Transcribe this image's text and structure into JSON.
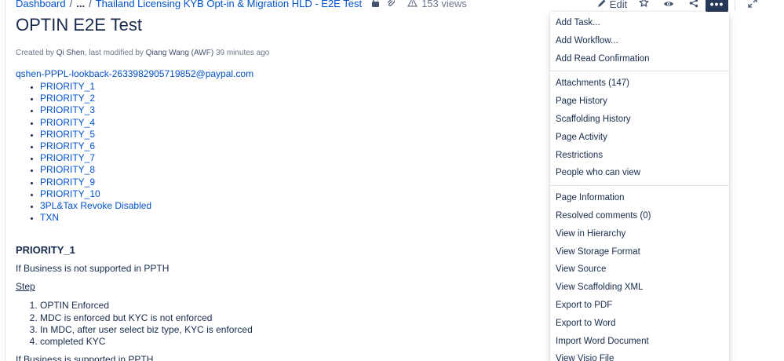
{
  "breadcrumb": {
    "root": "Dashboard",
    "sep1": "/",
    "ellipsis": "...",
    "sep2": "/",
    "parent": "Thailand Licensing KYB Opt-in & Migration HLD - E2E Test",
    "views": "153 views"
  },
  "toolbar": {
    "edit_label": "Edit",
    "more_label": "•••"
  },
  "page": {
    "title": "OPTIN E2E Test",
    "byline": {
      "created_prefix": "Created by",
      "creator": "Qi Shen",
      "modified_mid": ", last modified by",
      "modifier": "Qiang Wang (AWF)",
      "modified_suffix": "39 minutes ago"
    }
  },
  "content": {
    "email": "qshen-PPPL-lookback-2633982905719852@paypal.com",
    "links": [
      "PRIORITY_1",
      "PRIORITY_2",
      "PRIORITY_3",
      "PRIORITY_4",
      "PRIORITY_5",
      "PRIORITY_6",
      "PRIORITY_7",
      "PRIORITY_8",
      "PRIORITY_9",
      "PRIORITY_10",
      "3PL&Tax Revoke Disabled",
      "TXN"
    ],
    "section_heading": "PRIORITY_1",
    "section_intro": "If Business is not supported in PPTH",
    "step_label": "Step",
    "steps": [
      "OPTIN Enforced",
      "MDC is enforced but KYC is not enforced",
      "In MDC, after user select biz type, KYC is enforced",
      "completed KYC"
    ],
    "section_outro": "If Business is supported in PPTH"
  },
  "menu": {
    "group1": [
      "Add Task...",
      "Add Workflow...",
      "Add Read Confirmation"
    ],
    "group2": [
      "Attachments (147)",
      "Page History",
      "Scaffolding History",
      "Page Activity",
      "Restrictions",
      "People who can view"
    ],
    "group3": [
      "Page Information",
      "Resolved comments (0)",
      "View in Hierarchy",
      "View Storage Format",
      "View Source",
      "View Scaffolding XML",
      "Export to PDF",
      "Export to Word",
      "Import Word Document",
      "View Visio File"
    ]
  },
  "icons": {
    "lock": "lock-icon",
    "attachment": "paperclip-icon",
    "views": "analytics-icon",
    "edit": "pencil-icon",
    "star": "star-icon",
    "watch": "eye-icon",
    "share": "share-icon",
    "expand": "expand-icon"
  },
  "colors": {
    "link": "#0052cc",
    "text": "#172b4d",
    "subtle": "#6b778c",
    "more_button_bg": "#253858"
  }
}
